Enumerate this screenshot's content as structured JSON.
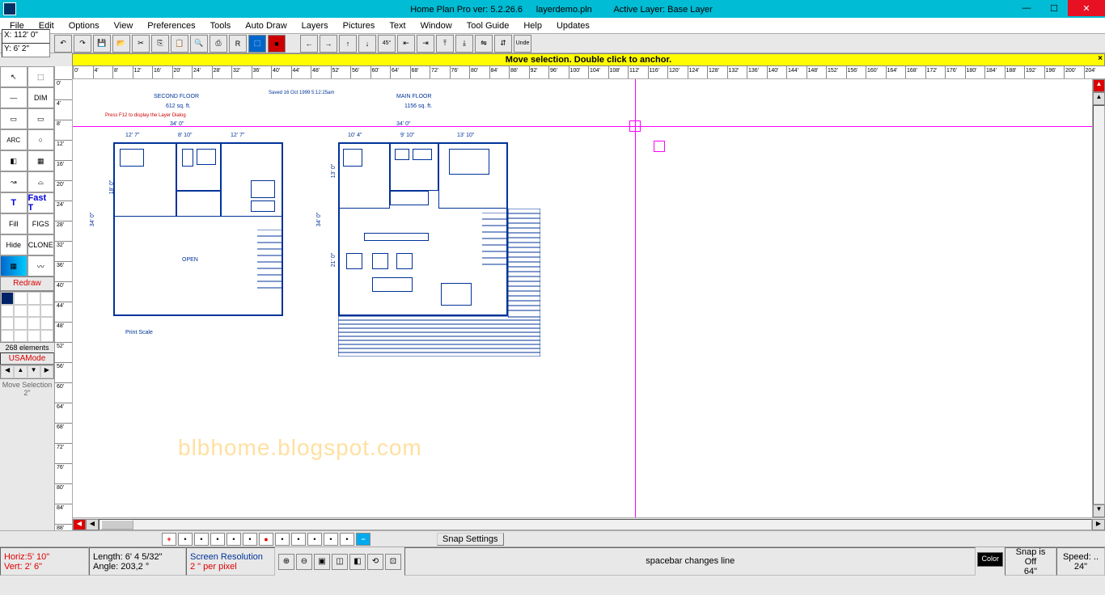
{
  "titlebar": {
    "app": "Home Plan Pro ver: 5.2.26.6",
    "file": "layerdemo.pln",
    "layer": "Active Layer: Base Layer"
  },
  "winbtns": {
    "min": "—",
    "max": "☐",
    "close": "✕"
  },
  "menu": [
    "File",
    "Edit",
    "Options",
    "View",
    "Preferences",
    "Tools",
    "Auto Draw",
    "Layers",
    "Pictures",
    "Text",
    "Window",
    "Tool Guide",
    "Help",
    "Updates"
  ],
  "coords": {
    "x": "X: 112' 0\"",
    "y": "Y: 6' 2\""
  },
  "yellowbar": {
    "msg": "Move selection. Double click to anchor.",
    "close": "×"
  },
  "left_tools": {
    "rows": [
      [
        "↖",
        "⬚"
      ],
      [
        "—",
        "DIM"
      ],
      [
        "▭",
        "▭"
      ],
      [
        "ARC",
        "○"
      ],
      [
        "◧",
        "▦"
      ],
      [
        "↝",
        "⌓"
      ],
      [
        "T",
        "Fast T"
      ],
      [
        "Fill",
        "FIGS"
      ],
      [
        "Hide",
        "CLONE"
      ],
      [
        "▦",
        "〰"
      ]
    ],
    "redraw": "Redraw",
    "elements": "268 elements",
    "usa": "USAMode",
    "nudge": [
      "◀",
      "▲",
      "▼",
      "▶"
    ],
    "move_sel": "Move Selection 2\""
  },
  "vruler_ticks": [
    "0'",
    "4'",
    "8'",
    "12'",
    "16'",
    "20'",
    "24'",
    "28'",
    "32'",
    "36'",
    "40'",
    "44'",
    "48'",
    "52'",
    "56'",
    "60'",
    "64'",
    "68'",
    "72'",
    "76'",
    "80'",
    "84'",
    "88'"
  ],
  "hruler_ticks": [
    "0'",
    "4'",
    "8'",
    "12'",
    "16'",
    "20'",
    "24'",
    "28'",
    "32'",
    "36'",
    "40'",
    "44'",
    "48'",
    "52'",
    "56'",
    "60'",
    "64'",
    "68'",
    "72'",
    "76'",
    "80'",
    "84'",
    "88'",
    "92'",
    "96'",
    "100'",
    "104'",
    "108'",
    "112'",
    "116'",
    "120'",
    "124'",
    "128'",
    "132'",
    "136'",
    "140'",
    "144'",
    "148'",
    "152'",
    "156'",
    "160'",
    "164'",
    "168'",
    "172'",
    "176'",
    "180'",
    "184'",
    "188'",
    "192'",
    "196'",
    "200'",
    "204'"
  ],
  "plan": {
    "left_title": "SECOND FLOOR",
    "left_area": "612 sq. ft.",
    "left_note": "Press  F12  to display the Layer Dialog",
    "saved": "Saved 16 Oct 1999  5:12:25am",
    "right_title": "MAIN FLOOR",
    "right_area": "1156 sq. ft.",
    "dim_34": "34' 0\"",
    "dims_l": [
      "12' 7\"",
      "8' 10\"",
      "12' 7\""
    ],
    "dims_r": [
      "10' 4\"",
      "9' 10\"",
      "13' 10\""
    ],
    "v_left_out": "34' 0\"",
    "v_left_in": "18' 0\"",
    "v_right_out": "34' 0\"",
    "v_right_top": "13' 0\"",
    "v_right_bot": "21' 0\"",
    "open": "OPEN",
    "printscale": "Print Scale"
  },
  "watermark": "blbhome.blogspot.com",
  "snap": {
    "plus": "+",
    "minus": "−",
    "settings": "Snap Settings"
  },
  "status": {
    "horiz": "Horiz:5' 10\"",
    "vert": "Vert: 2' 6\"",
    "length": "Length: 6' 4 5/32\"",
    "angle": "Angle: 203,2 °",
    "res_label": "Screen Resolution",
    "res_val": "2 \" per pixel",
    "msg": "spacebar changes line",
    "colorbtn": "Color",
    "snap": "Snap is Off",
    "snapval": "64\"",
    "speed": "Speed:  ..",
    "speedval": "24\""
  }
}
